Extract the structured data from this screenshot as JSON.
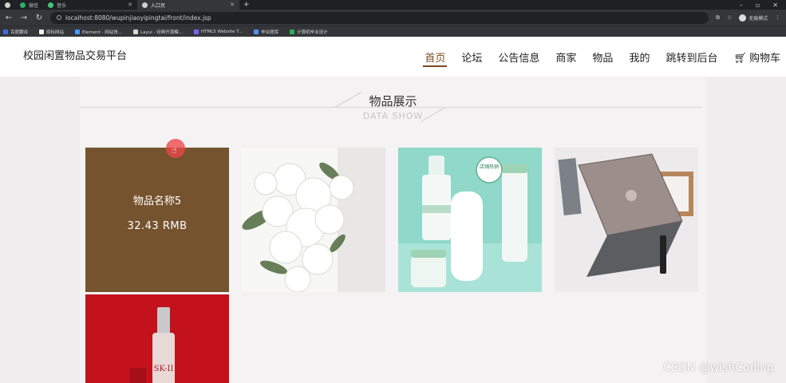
{
  "browser": {
    "tabs": [
      {
        "label": "",
        "active": false
      },
      {
        "label": "微信",
        "active": false
      },
      {
        "label": "音乐",
        "active": false
      },
      {
        "label": "入口页",
        "active": true
      }
    ],
    "url": "localhost:8080/wupinjiaoyipingtai/front/index.jsp",
    "profile_label": "无痕模式",
    "bookmarks": [
      {
        "label": "百度翻译",
        "color": "#3b6fe0"
      },
      {
        "label": "原标网站",
        "color": "#eeeeee"
      },
      {
        "label": "Element - 网站快...",
        "color": "#409eff"
      },
      {
        "label": "Layui - 经典开源模...",
        "color": "#d7d7d7"
      },
      {
        "label": "HTML5 Website T...",
        "color": "#7b61ff"
      },
      {
        "label": "毕业题库",
        "color": "#5b8cff"
      },
      {
        "label": "计算机毕业设计",
        "color": "#2eae52"
      }
    ]
  },
  "site": {
    "title": "校园闲置物品交易平台",
    "nav": [
      {
        "label": "首页",
        "active": true
      },
      {
        "label": "论坛",
        "active": false
      },
      {
        "label": "公告信息",
        "active": false
      },
      {
        "label": "商家",
        "active": false
      },
      {
        "label": "物品",
        "active": false
      },
      {
        "label": "我的",
        "active": false
      },
      {
        "label": "跳转到后台",
        "active": false
      },
      {
        "label": "购物车",
        "active": false,
        "icon": "cart-icon"
      }
    ]
  },
  "section": {
    "title": "物品展示",
    "subtitle": "DATA SHOW"
  },
  "products": [
    {
      "name": "物品名称5",
      "price": "32.43 RMB",
      "hovered": true,
      "image": "brown-overlay"
    },
    {
      "name": "",
      "price": "",
      "hovered": false,
      "image": "white-flowers"
    },
    {
      "name": "",
      "price": "",
      "hovered": false,
      "image": "mint-skincare-bottles"
    },
    {
      "name": "",
      "price": "",
      "hovered": false,
      "image": "gaming-laptop"
    },
    {
      "name": "",
      "price": "",
      "hovered": false,
      "image": "skii-bottle-red"
    }
  ],
  "image_text": {
    "skincare_badge": "店铺热销",
    "bottle_brand": "SK-II"
  },
  "watermark": "CSDN @wishCoding",
  "colors": {
    "accent": "#7a4a22",
    "hover_overlay": "#76532f",
    "cursor_dot": "#eb4646"
  }
}
